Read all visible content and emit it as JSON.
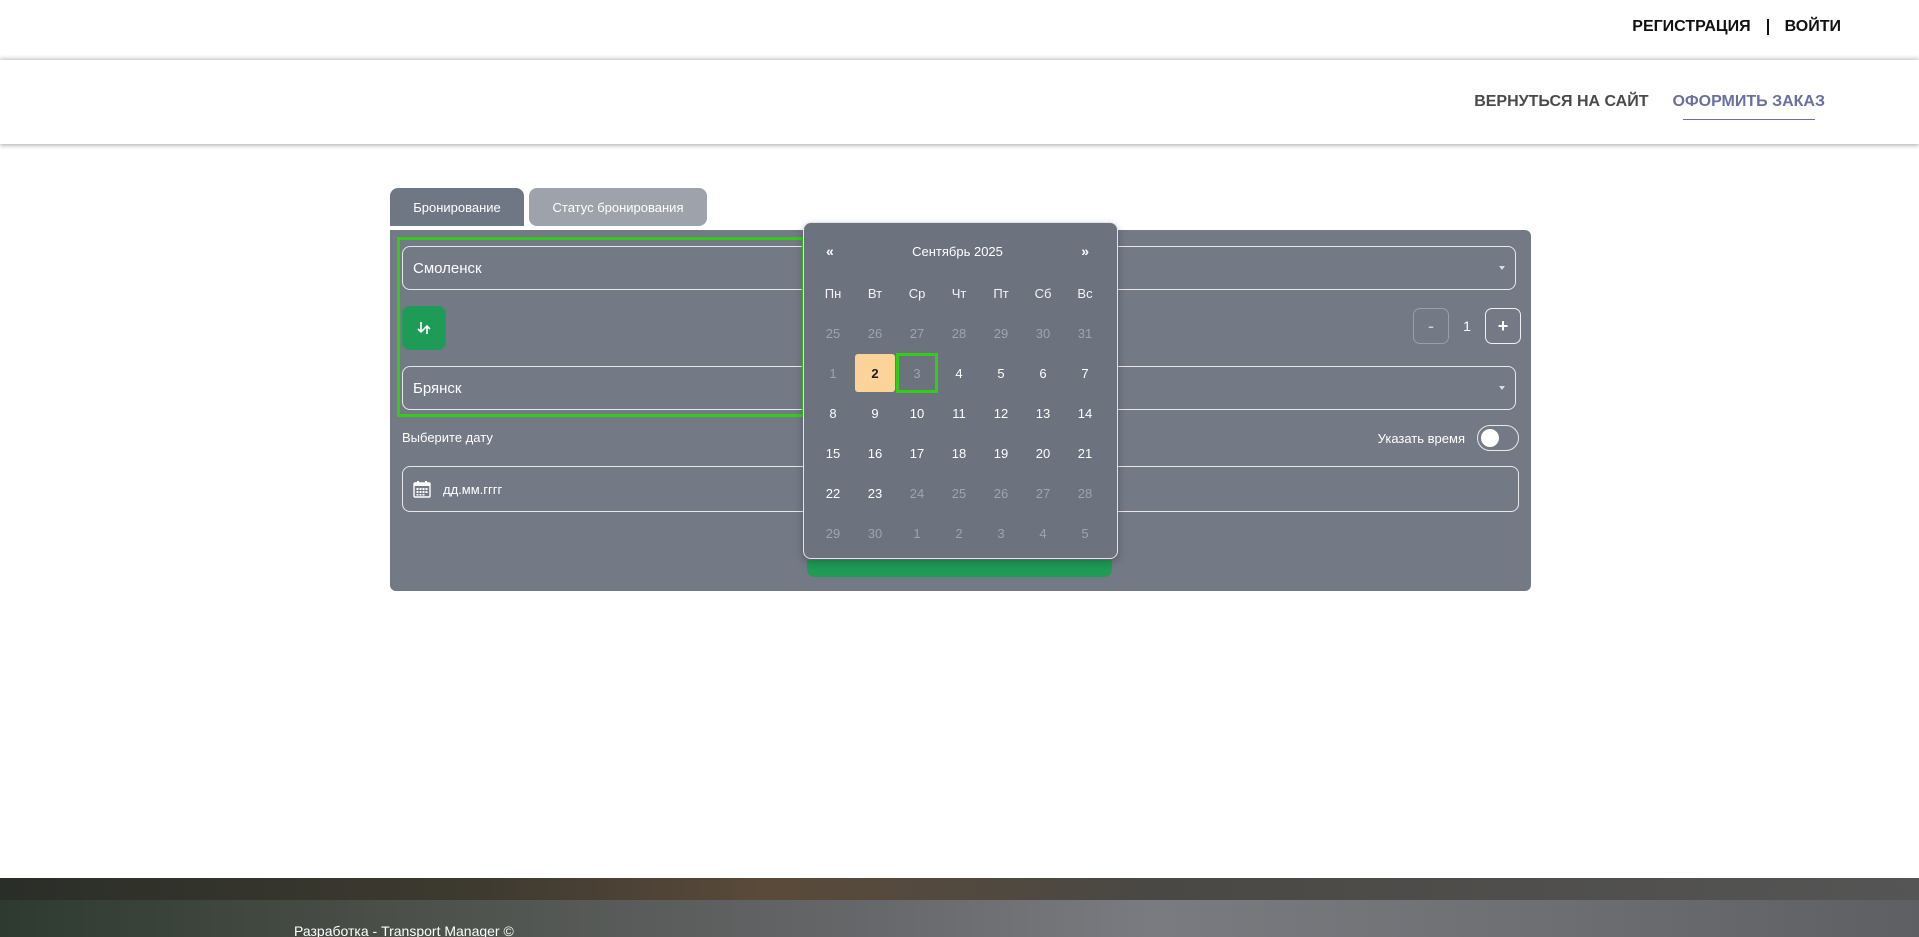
{
  "header": {
    "register": "РЕГИСТРАЦИЯ",
    "login": "ВОЙТИ"
  },
  "nav": {
    "back_to_site": "ВЕРНУТЬСЯ НА САЙТ",
    "order": "ОФОРМИТЬ ЗАКАЗ"
  },
  "tabs": {
    "booking": "Бронирование",
    "status": "Статус бронирования"
  },
  "form": {
    "from": "Смоленск",
    "to": "Брянск",
    "swap_icon": "swap-vertical-icon",
    "passengers": "1",
    "minus": "-",
    "plus": "+",
    "date_label": "Выберите дату",
    "time_label": "Указать время",
    "date_placeholder": "дд.мм.гггг",
    "calendar_icon": "calendar-icon"
  },
  "calendar": {
    "title": "Сентябрь 2025",
    "prev": "«",
    "next": "»",
    "weekdays": [
      "Пн",
      "Вт",
      "Ср",
      "Чт",
      "Пт",
      "Сб",
      "Вс"
    ],
    "weeks": [
      [
        {
          "d": "25",
          "m": true
        },
        {
          "d": "26",
          "m": true
        },
        {
          "d": "27",
          "m": true
        },
        {
          "d": "28",
          "m": true
        },
        {
          "d": "29",
          "m": true
        },
        {
          "d": "30",
          "m": true
        },
        {
          "d": "31",
          "m": true
        }
      ],
      [
        {
          "d": "1",
          "m": true
        },
        {
          "d": "2",
          "today": true
        },
        {
          "d": "3",
          "m": true,
          "sel": true
        },
        {
          "d": "4"
        },
        {
          "d": "5"
        },
        {
          "d": "6"
        },
        {
          "d": "7"
        }
      ],
      [
        {
          "d": "8"
        },
        {
          "d": "9"
        },
        {
          "d": "10"
        },
        {
          "d": "11"
        },
        {
          "d": "12"
        },
        {
          "d": "13"
        },
        {
          "d": "14"
        }
      ],
      [
        {
          "d": "15"
        },
        {
          "d": "16"
        },
        {
          "d": "17"
        },
        {
          "d": "18"
        },
        {
          "d": "19"
        },
        {
          "d": "20"
        },
        {
          "d": "21"
        }
      ],
      [
        {
          "d": "22"
        },
        {
          "d": "23"
        },
        {
          "d": "24",
          "m": true
        },
        {
          "d": "25",
          "m": true
        },
        {
          "d": "26",
          "m": true
        },
        {
          "d": "27",
          "m": true
        },
        {
          "d": "28",
          "m": true
        }
      ],
      [
        {
          "d": "29",
          "m": true
        },
        {
          "d": "30",
          "m": true
        },
        {
          "d": "1",
          "m": true
        },
        {
          "d": "2",
          "m": true
        },
        {
          "d": "3",
          "m": true
        },
        {
          "d": "4",
          "m": true
        },
        {
          "d": "5",
          "m": true
        }
      ]
    ]
  },
  "footer": {
    "text": "Разработка - Transport Manager ©"
  },
  "colors": {
    "card_bg": "#737985",
    "accent_green": "#1e9b55",
    "today_bg": "#fcd499",
    "highlight": "#34cc1a",
    "nav_active": "#6a6fa0"
  }
}
